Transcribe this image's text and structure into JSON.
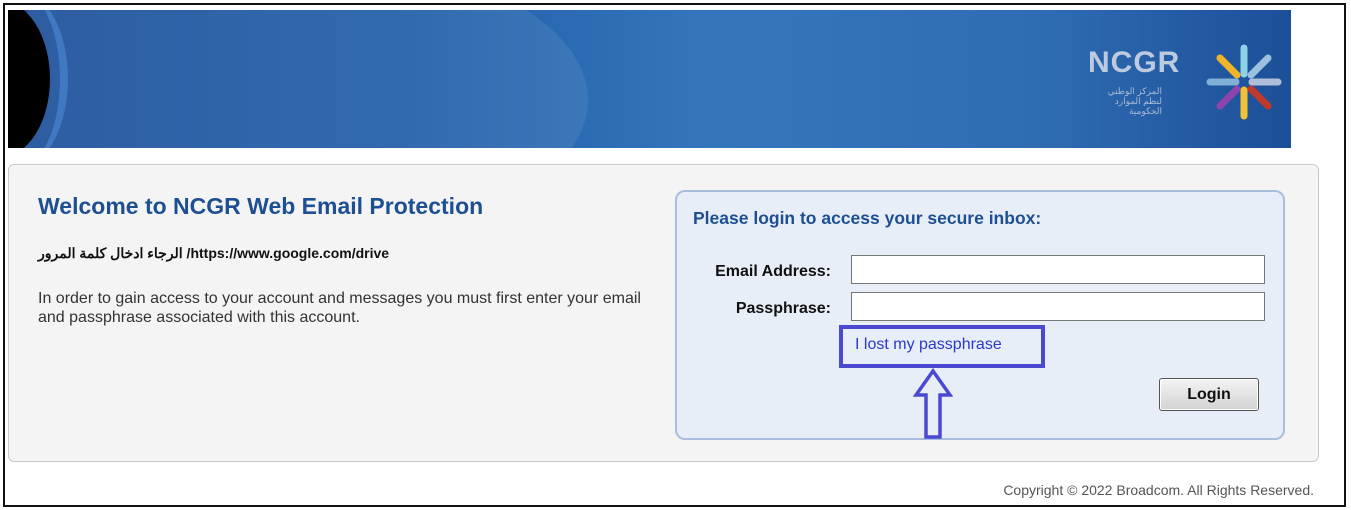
{
  "header": {
    "logo_text": "NCGR",
    "logo_subtitle": "المركز الوطني لنظم الموارد الحكومية",
    "brand_colors": {
      "banner": "#1f5da8",
      "title": "#1d4f92"
    }
  },
  "main": {
    "title": "Welcome to NCGR Web Email Protection",
    "url_line": "الرجاء ادخال كلمة المرور /https://www.google.com/drive",
    "info": "In order to gain access to your account and messages you must first enter your email and passphrase associated with this account."
  },
  "login": {
    "title": "Please login to access your secure inbox:",
    "email_label": "Email Address:",
    "email_value": "",
    "passphrase_label": "Passphrase:",
    "passphrase_value": "",
    "lost_link": "I lost my passphrase",
    "button": "Login",
    "highlight_color": "#4a4ad0",
    "arrow_icon": "up-arrow-outline-icon"
  },
  "footer": {
    "copyright": "Copyright © 2022 Broadcom. All Rights Reserved."
  }
}
